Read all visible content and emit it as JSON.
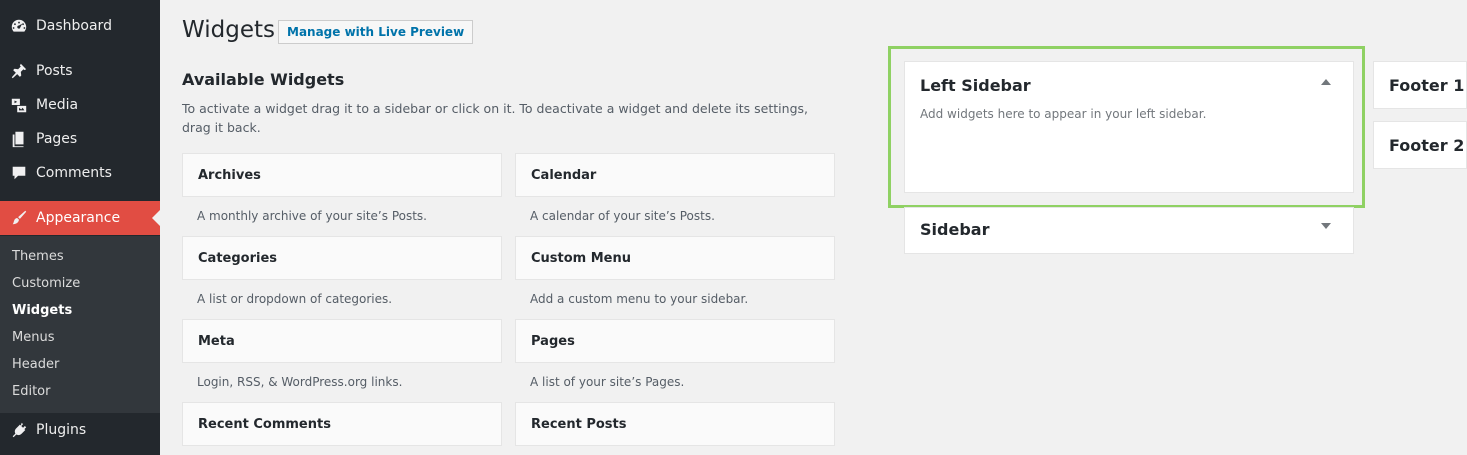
{
  "page": {
    "title": "Widgets",
    "live_preview_label": "Manage with Live Preview"
  },
  "menu": {
    "dashboard": "Dashboard",
    "posts": "Posts",
    "media": "Media",
    "pages": "Pages",
    "comments": "Comments",
    "appearance": "Appearance",
    "plugins": "Plugins",
    "submenu": [
      "Themes",
      "Customize",
      "Widgets",
      "Menus",
      "Header",
      "Editor"
    ],
    "current_submenu": "Widgets",
    "active_color": "#e14d43"
  },
  "available": {
    "title": "Available Widgets",
    "description": "To activate a widget drag it to a sidebar or click on it. To deactivate a widget and delete its settings, drag it back.",
    "widgets": [
      {
        "name": "Archives",
        "desc": "A monthly archive of your site’s Posts."
      },
      {
        "name": "Calendar",
        "desc": "A calendar of your site’s Posts."
      },
      {
        "name": "Categories",
        "desc": "A list or dropdown of categories."
      },
      {
        "name": "Custom Menu",
        "desc": "Add a custom menu to your sidebar."
      },
      {
        "name": "Meta",
        "desc": "Login, RSS, & WordPress.org links."
      },
      {
        "name": "Pages",
        "desc": "A list of your site’s Pages."
      },
      {
        "name": "Recent Comments",
        "desc": ""
      },
      {
        "name": "Recent Posts",
        "desc": ""
      }
    ]
  },
  "sidebars": {
    "left": {
      "name": "Left Sidebar",
      "desc": "Add widgets here to appear in your left sidebar."
    },
    "sidebar": {
      "name": "Sidebar"
    },
    "footer1": {
      "name": "Footer 1"
    },
    "footer2": {
      "name": "Footer 2"
    },
    "highlight_color": "#8fd163"
  },
  "icons": [
    "dashboard-icon",
    "pin-icon",
    "media-icon",
    "pages-icon",
    "comments-icon",
    "paintbrush-icon",
    "plugins-icon",
    "chevron-up-icon",
    "chevron-down-icon"
  ]
}
